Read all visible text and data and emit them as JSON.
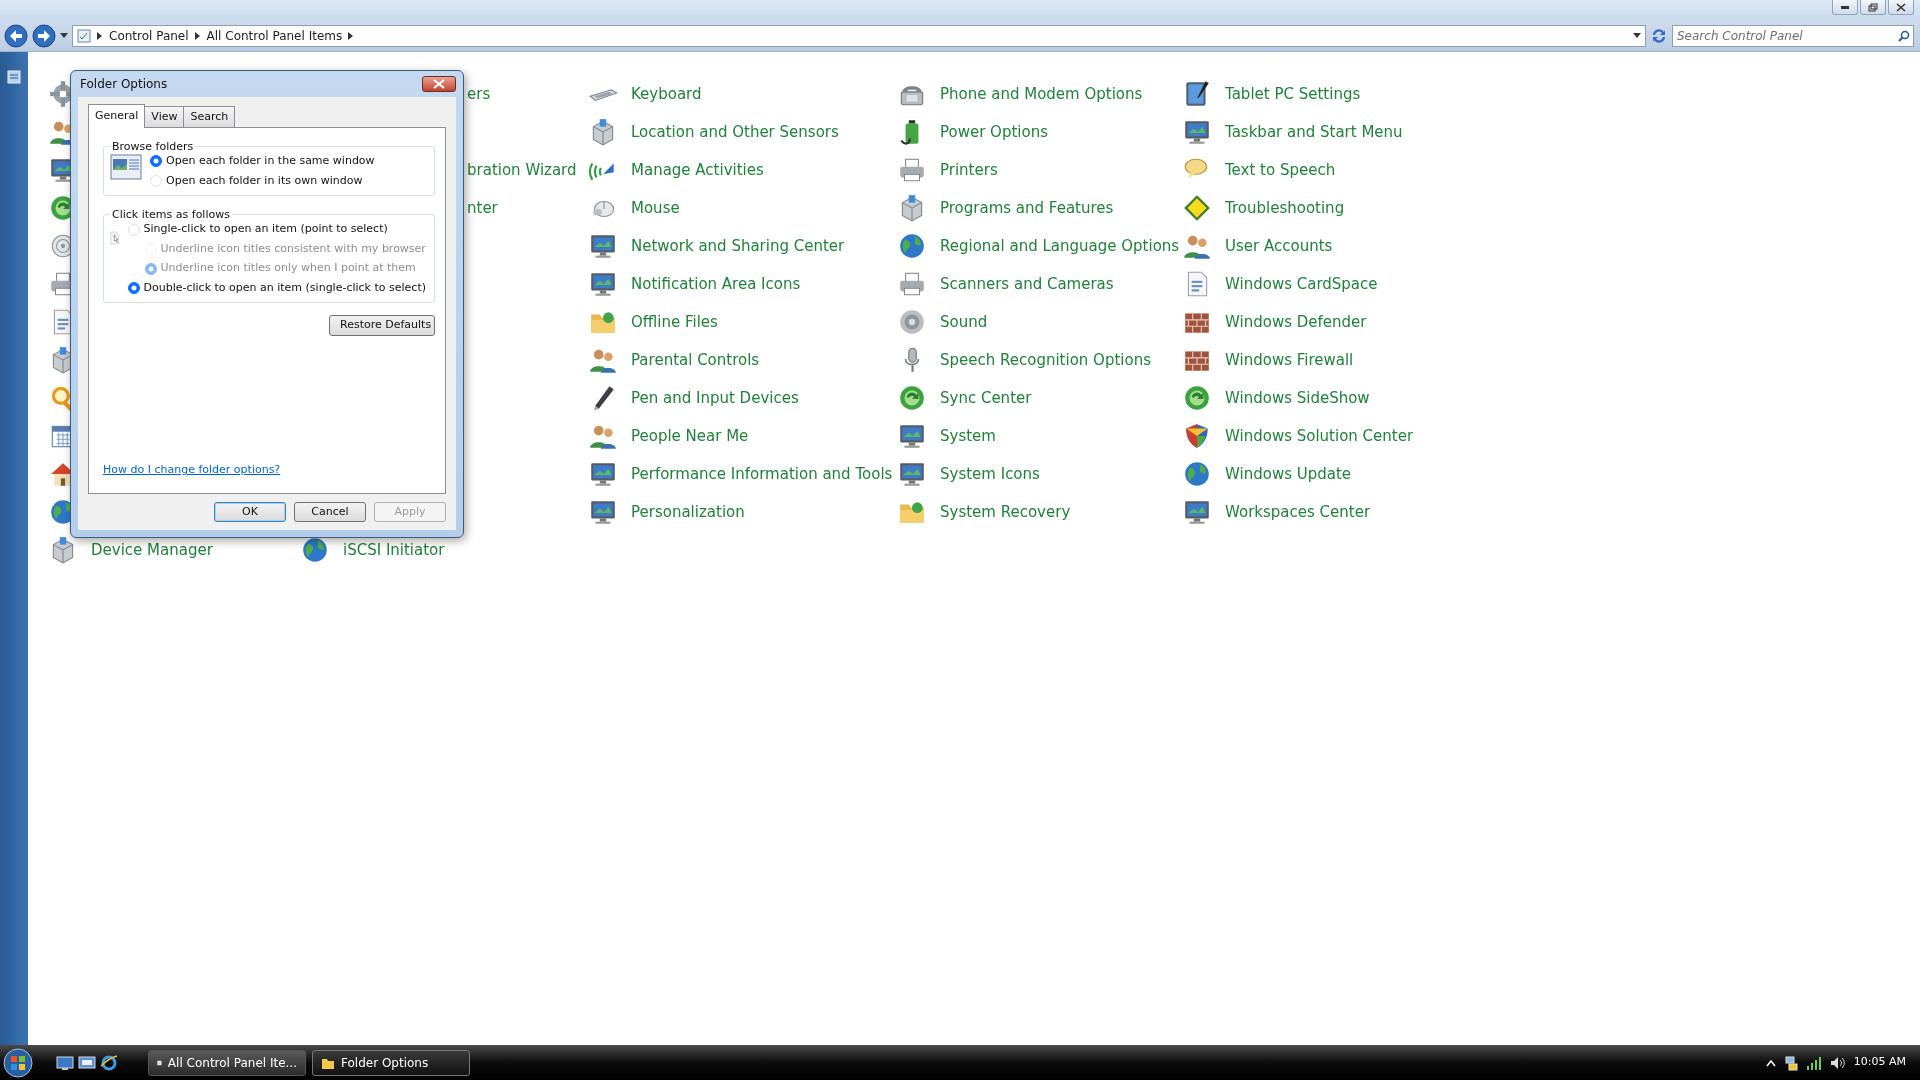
{
  "window": {
    "breadcrumbs": [
      "Control Panel",
      "All Control Panel Items"
    ],
    "search": {
      "placeholder": "Search Control Panel"
    }
  },
  "columns": [
    [
      {
        "kind": "icon"
      },
      {
        "kind": "icon"
      },
      {
        "kind": "icon"
      },
      {
        "kind": "icon"
      },
      {
        "kind": "icon"
      },
      {
        "kind": "icon"
      },
      {
        "kind": "icon"
      },
      {
        "kind": "icon"
      },
      {
        "kind": "icon"
      },
      {
        "kind": "icon"
      },
      {
        "kind": "icon"
      },
      {
        "kind": "icon"
      },
      {
        "kind": "full",
        "label": "Device Manager"
      }
    ],
    [
      {
        "kind": "partial",
        "label": "ers"
      },
      null,
      {
        "kind": "partial",
        "label": "bration Wizard"
      },
      {
        "kind": "partial",
        "label": "nter"
      },
      null,
      null,
      null,
      null,
      null,
      null,
      null,
      null,
      {
        "kind": "full",
        "label": "iSCSI Initiator"
      }
    ],
    [
      {
        "kind": "full",
        "label": "Keyboard"
      },
      {
        "kind": "full",
        "label": "Location and Other Sensors"
      },
      {
        "kind": "full",
        "label": "Manage Activities"
      },
      {
        "kind": "full",
        "label": "Mouse"
      },
      {
        "kind": "full",
        "label": "Network and Sharing Center"
      },
      {
        "kind": "full",
        "label": "Notification Area Icons"
      },
      {
        "kind": "full",
        "label": "Offline Files"
      },
      {
        "kind": "full",
        "label": "Parental Controls"
      },
      {
        "kind": "full",
        "label": "Pen and Input Devices"
      },
      {
        "kind": "full",
        "label": "People Near Me"
      },
      {
        "kind": "full",
        "label": "Performance Information and Tools"
      },
      {
        "kind": "full",
        "label": "Personalization"
      }
    ],
    [
      {
        "kind": "full",
        "label": "Phone and Modem Options"
      },
      {
        "kind": "full",
        "label": "Power Options"
      },
      {
        "kind": "full",
        "label": "Printers"
      },
      {
        "kind": "full",
        "label": "Programs and Features"
      },
      {
        "kind": "full",
        "label": "Regional and Language Options"
      },
      {
        "kind": "full",
        "label": "Scanners and Cameras"
      },
      {
        "kind": "full",
        "label": "Sound"
      },
      {
        "kind": "full",
        "label": "Speech Recognition Options"
      },
      {
        "kind": "full",
        "label": "Sync Center"
      },
      {
        "kind": "full",
        "label": "System"
      },
      {
        "kind": "full",
        "label": "System Icons"
      },
      {
        "kind": "full",
        "label": "System Recovery"
      }
    ],
    [
      {
        "kind": "full",
        "label": "Tablet PC Settings"
      },
      {
        "kind": "full",
        "label": "Taskbar and Start Menu"
      },
      {
        "kind": "full",
        "label": "Text to Speech"
      },
      {
        "kind": "full",
        "label": "Troubleshooting"
      },
      {
        "kind": "full",
        "label": "User Accounts"
      },
      {
        "kind": "full",
        "label": "Windows CardSpace"
      },
      {
        "kind": "full",
        "label": "Windows Defender"
      },
      {
        "kind": "full",
        "label": "Windows Firewall"
      },
      {
        "kind": "full",
        "label": "Windows SideShow"
      },
      {
        "kind": "full",
        "label": "Windows Solution Center"
      },
      {
        "kind": "full",
        "label": "Windows Update"
      },
      {
        "kind": "full",
        "label": "Workspaces Center"
      }
    ]
  ],
  "dialog": {
    "title": "Folder Options",
    "tabs": [
      {
        "label": "General",
        "selected": true
      },
      {
        "label": "View",
        "selected": false
      },
      {
        "label": "Search",
        "selected": false
      }
    ],
    "groups": [
      {
        "title": "Browse folders",
        "options": [
          {
            "label": "Open each folder in the same window",
            "checked": true,
            "disabled": false
          },
          {
            "label": "Open each folder in its own window",
            "checked": false,
            "disabled": false
          }
        ]
      },
      {
        "title": "Click items as follows",
        "options": [
          {
            "label": "Single-click to open an item (point to select)",
            "checked": false,
            "disabled": false,
            "children": [
              {
                "label": "Underline icon titles consistent with my browser",
                "checked": false,
                "disabled": true
              },
              {
                "label": "Underline icon titles only when I point at them",
                "checked": true,
                "disabled": true
              }
            ]
          },
          {
            "label": "Double-click to open an item (single-click to select)",
            "checked": true,
            "disabled": false
          }
        ]
      }
    ],
    "restore_button": "Restore Defaults",
    "help_link": "How do I change folder options?",
    "buttons": [
      {
        "label": "OK",
        "default": true,
        "disabled": false
      },
      {
        "label": "Cancel",
        "default": false,
        "disabled": false
      },
      {
        "label": "Apply",
        "default": false,
        "disabled": true
      }
    ]
  },
  "taskbar": {
    "tasks": [
      {
        "label": "All Control Panel Ite...",
        "selected": false
      },
      {
        "label": "Folder Options",
        "selected": true
      }
    ],
    "clock": "10:05 AM"
  }
}
